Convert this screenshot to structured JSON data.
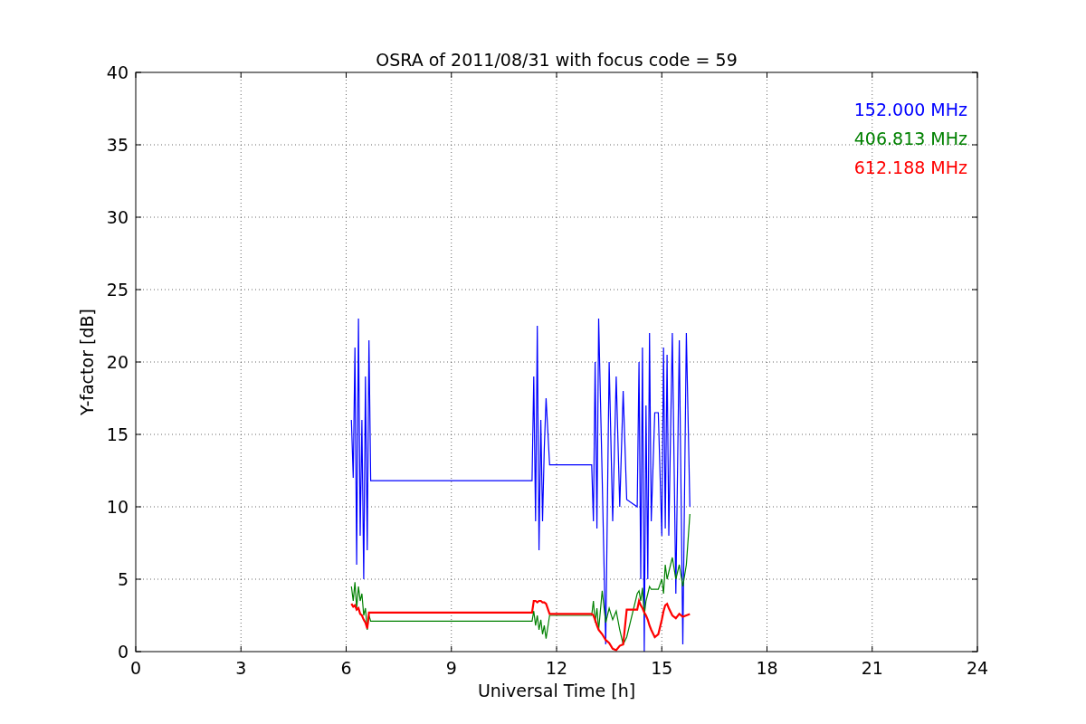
{
  "chart_data": {
    "type": "line",
    "title": "OSRA of 2011/08/31 with focus code = 59",
    "xlabel": "Universal Time [h]",
    "ylabel": "Y-factor [dB]",
    "x": [
      6.15,
      6.2,
      6.25,
      6.3,
      6.35,
      6.4,
      6.45,
      6.5,
      6.55,
      6.6,
      6.65,
      6.7,
      11.3,
      11.35,
      11.4,
      11.45,
      11.5,
      11.55,
      11.6,
      11.65,
      11.7,
      11.8,
      13.0,
      13.05,
      13.1,
      13.15,
      13.2,
      13.3,
      13.4,
      13.5,
      13.6,
      13.7,
      13.8,
      13.9,
      14.0,
      14.3,
      14.35,
      14.4,
      14.45,
      14.5,
      14.55,
      14.6,
      14.65,
      14.7,
      14.8,
      14.9,
      15.0,
      15.05,
      15.1,
      15.15,
      15.2,
      15.3,
      15.4,
      15.5,
      15.6,
      15.7,
      15.8
    ],
    "series": [
      {
        "name": "152.000 MHz",
        "color": "#0000ff",
        "values": [
          16,
          12,
          21,
          6,
          23,
          8,
          16,
          5,
          19,
          7,
          21.5,
          11.8,
          11.8,
          19,
          9,
          22.5,
          7,
          16,
          9,
          14,
          17.5,
          12.9,
          12.9,
          9,
          20,
          8.5,
          23,
          12,
          0.5,
          20,
          9,
          19,
          10,
          18,
          10.5,
          10,
          20,
          5,
          21,
          0,
          17,
          5,
          22,
          9,
          16.5,
          16.5,
          8,
          21,
          8.5,
          20.5,
          8,
          22,
          4,
          21.5,
          0.5,
          22,
          10
        ]
      },
      {
        "name": "406.813 MHz",
        "color": "#008000",
        "values": [
          4.5,
          3.5,
          4.8,
          3,
          4.5,
          3.5,
          4,
          2.5,
          3,
          1.5,
          2.5,
          2.1,
          2.1,
          2.8,
          1.8,
          2.5,
          1.5,
          2.2,
          1.2,
          1.8,
          0.9,
          2.5,
          2.5,
          3.5,
          2,
          3,
          1.5,
          4.2,
          2,
          3,
          2.2,
          2.8,
          1.5,
          0.5,
          1,
          4,
          4.2,
          3.5,
          4.4,
          2.5,
          3.5,
          4,
          4.5,
          4.3,
          4.3,
          4.3,
          5,
          4,
          6,
          5,
          5.5,
          6.5,
          5,
          6,
          4.5,
          6,
          9.5
        ]
      },
      {
        "name": "612.188 MHz",
        "color": "#ff0000",
        "values": [
          3.3,
          3.1,
          3.2,
          2.9,
          3,
          2.6,
          2.5,
          2.2,
          2,
          1.6,
          2.7,
          2.7,
          2.7,
          3.5,
          3.5,
          3.4,
          3.5,
          3.5,
          3.4,
          3.4,
          3.3,
          2.6,
          2.6,
          2.5,
          2.2,
          1.8,
          1.5,
          1.2,
          0.8,
          0.6,
          0.2,
          0.1,
          0.4,
          0.5,
          2.9,
          2.9,
          3.5,
          3.2,
          3,
          2.7,
          2.5,
          2.2,
          1.8,
          1.5,
          1,
          1.2,
          2.2,
          2.8,
          3.2,
          3.3,
          3,
          2.5,
          2.3,
          2.6,
          2.4,
          2.5,
          2.6
        ]
      }
    ],
    "grid": true,
    "xlim": [
      0,
      24
    ],
    "ylim": [
      0,
      40
    ],
    "xticks": [
      0,
      3,
      6,
      9,
      12,
      15,
      18,
      21,
      24
    ],
    "yticks": [
      0,
      5,
      10,
      15,
      20,
      25,
      30,
      35,
      40
    ]
  }
}
